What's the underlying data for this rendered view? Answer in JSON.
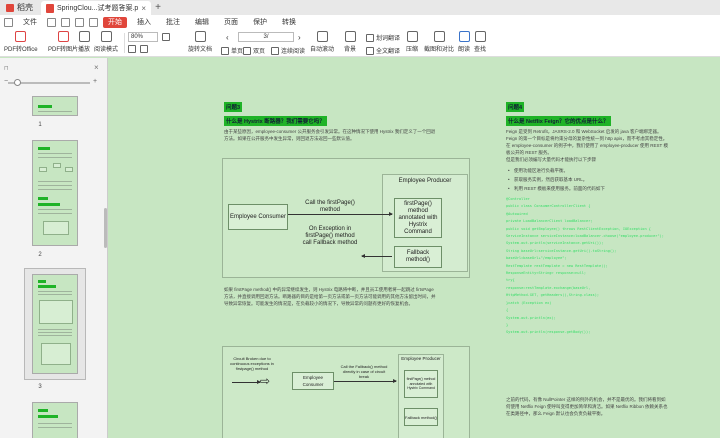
{
  "tabs": {
    "home": "稻壳",
    "doc": "SpringClou...试考题答案.pdf",
    "new": "+"
  },
  "menu": {
    "file": "文件",
    "items": [
      "开始",
      "插入",
      "批注",
      "编辑",
      "页面",
      "保护",
      "转换"
    ],
    "active_index": 0
  },
  "toolbar": {
    "pdf_office": "PDF转Office",
    "pdf_image": "PDF转图片",
    "play": "播放",
    "read_mode": "阅读模式",
    "zoom": "80%",
    "rotate": "旋转文档",
    "page_current": "3",
    "page_sep": "/",
    "single": "单页",
    "double": "双页",
    "continuous": "连续阅读",
    "auto_scroll": "自动滚动",
    "background": "背景",
    "translate": "划词翻译",
    "full_translate": "全文翻译",
    "compress": "压缩",
    "screenshot": "截图和对比",
    "read_aloud": "朗读",
    "find": "查找"
  },
  "sidebar": {
    "pages": [
      "1",
      "2",
      "3"
    ],
    "current_page": "3"
  },
  "page_left": {
    "heading_num": "问题3",
    "heading": "什么是 Hystrix 断路器？我们需要它吗？",
    "para1": "由于某些原因，employee-consumer 公开服务会引发异常。在这种情况下使用 Hystrix 我们定义了一个回退方法。如果在公开服务中发生异常，则回退方法返回一些默认值。",
    "diagram": {
      "producer_title": "Employee Producer",
      "consumer": "Employee Consumer",
      "call_label": "Call the firstPage() method",
      "first_page": "firstPage() method annotated with Hystrix Command",
      "exception_label": "On Exception in firstPage() method call Fallback method",
      "fallback": "Fallback method()"
    },
    "para2": "如果 firstPage method() 中的异常继续发生，则 Hystrix 电路将中断，并且员工使用者将一起跳过 firtsPage 方法，并直接调用回退方法。断路器的目的是给第一页方法或第一页方法可能调用的其他方法留出时间，并导致异常恢复。可能发生的情况是，在负载较小的情况下，导致异常的问题有更好的恢复机会。",
    "diagram2": {
      "circuit_label": "Circuit Broken due to continuous exceptions in firstpage() method",
      "consumer": "Employee Consumer",
      "call_label": "Call the Fallback() method directly in case of circuit break",
      "producer_title": "Employee Producer",
      "first_page": "firstPage() method annotated with Hystrix Command",
      "fallback": "Fallback method()"
    }
  },
  "page_right": {
    "heading_num": "问题4",
    "heading": "什么是 Netflix Feign？它的优点是什么？",
    "para1": "Feign 是受到 Retrofit，JAXRS-2.0 和 WebSocket 启发的 java 客户端绑定器。Feign 的第一个目标是将约束分母的复杂性统一到 http apis，而不考虑其稳定性。在 employee-consumer 的例子中，我们使用了 employee-producer 使用 REST 模板公开的 REST 服务。",
    "para2": "但是我们必须编写大量代码才能执行以下步骤",
    "bullets": [
      "使用功能区进行负载平衡。",
      "获取服务实例，然后获取基本 URL。",
      "利用 REST 模板来使用服务。前面的代码如下"
    ],
    "code": [
      "@Controller",
      "public class ConsumerControllerClient {",
      "",
      "@Autowired",
      "private LoadBalancerClient loadBalancer;",
      "",
      "public void getEmployee() throws RestClientException, IOException {",
      "",
      "    ServiceInstance serviceInstance=loadBalancer.choose(\"employee-producer\");",
      "",
      "    System.out.println(serviceInstance.getUri());",
      "",
      "    String baseUrl=serviceInstance.getUri().toString();",
      "",
      "    baseUrl=baseUrl+\"/employee\";",
      "",
      "    RestTemplate restTemplate = new RestTemplate();",
      "    ResponseEntity<String> response=null;",
      "    try{",
      "    response=restTemplate.exchange(baseUrl,",
      "            HttpMethod.GET, getHeaders(),String.class);",
      "    }catch (Exception ex)",
      "    {",
      "        System.out.println(ex);",
      "    }",
      "    System.out.println(response.getBody());"
    ],
    "para3": "之前的代码，有像 NullPointer 这样的例外的机会，并不是最优的。我们将看到如何使用 Netflix Feign 使呼叫变得更加简单和清洁。如果 Netflix Ribbon 依赖关系也在类路径中，那么 Feign 默认也会负责负载平衡。"
  }
}
